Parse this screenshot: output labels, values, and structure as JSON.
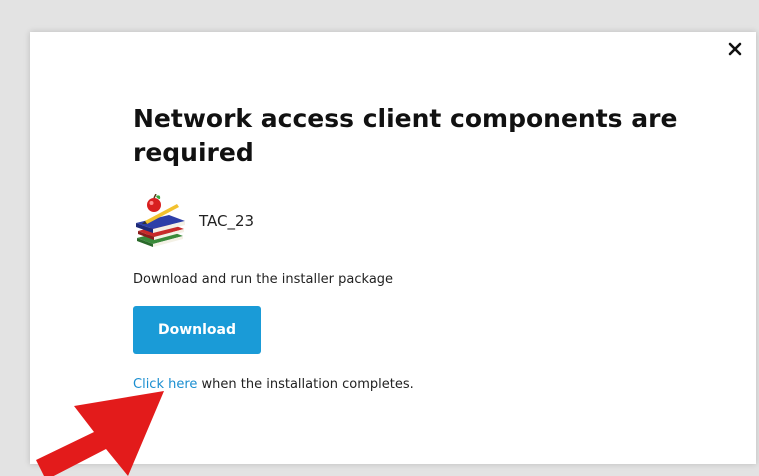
{
  "dialog": {
    "close_symbol": "×",
    "title": "Network access client components are required",
    "app": {
      "name": "TAC_23",
      "icon": "books-with-apple-icon"
    },
    "instruction": "Download and run the installer package",
    "download_label": "Download",
    "completion": {
      "link_text": "Click here",
      "rest_text": " when the installation completes."
    }
  },
  "annotation": {
    "icon": "red-arrow-icon",
    "color": "#e31b1b"
  },
  "colors": {
    "page_background": "#e3e3e3",
    "accent": "#1a9bd7",
    "link": "#1a8ed0"
  }
}
